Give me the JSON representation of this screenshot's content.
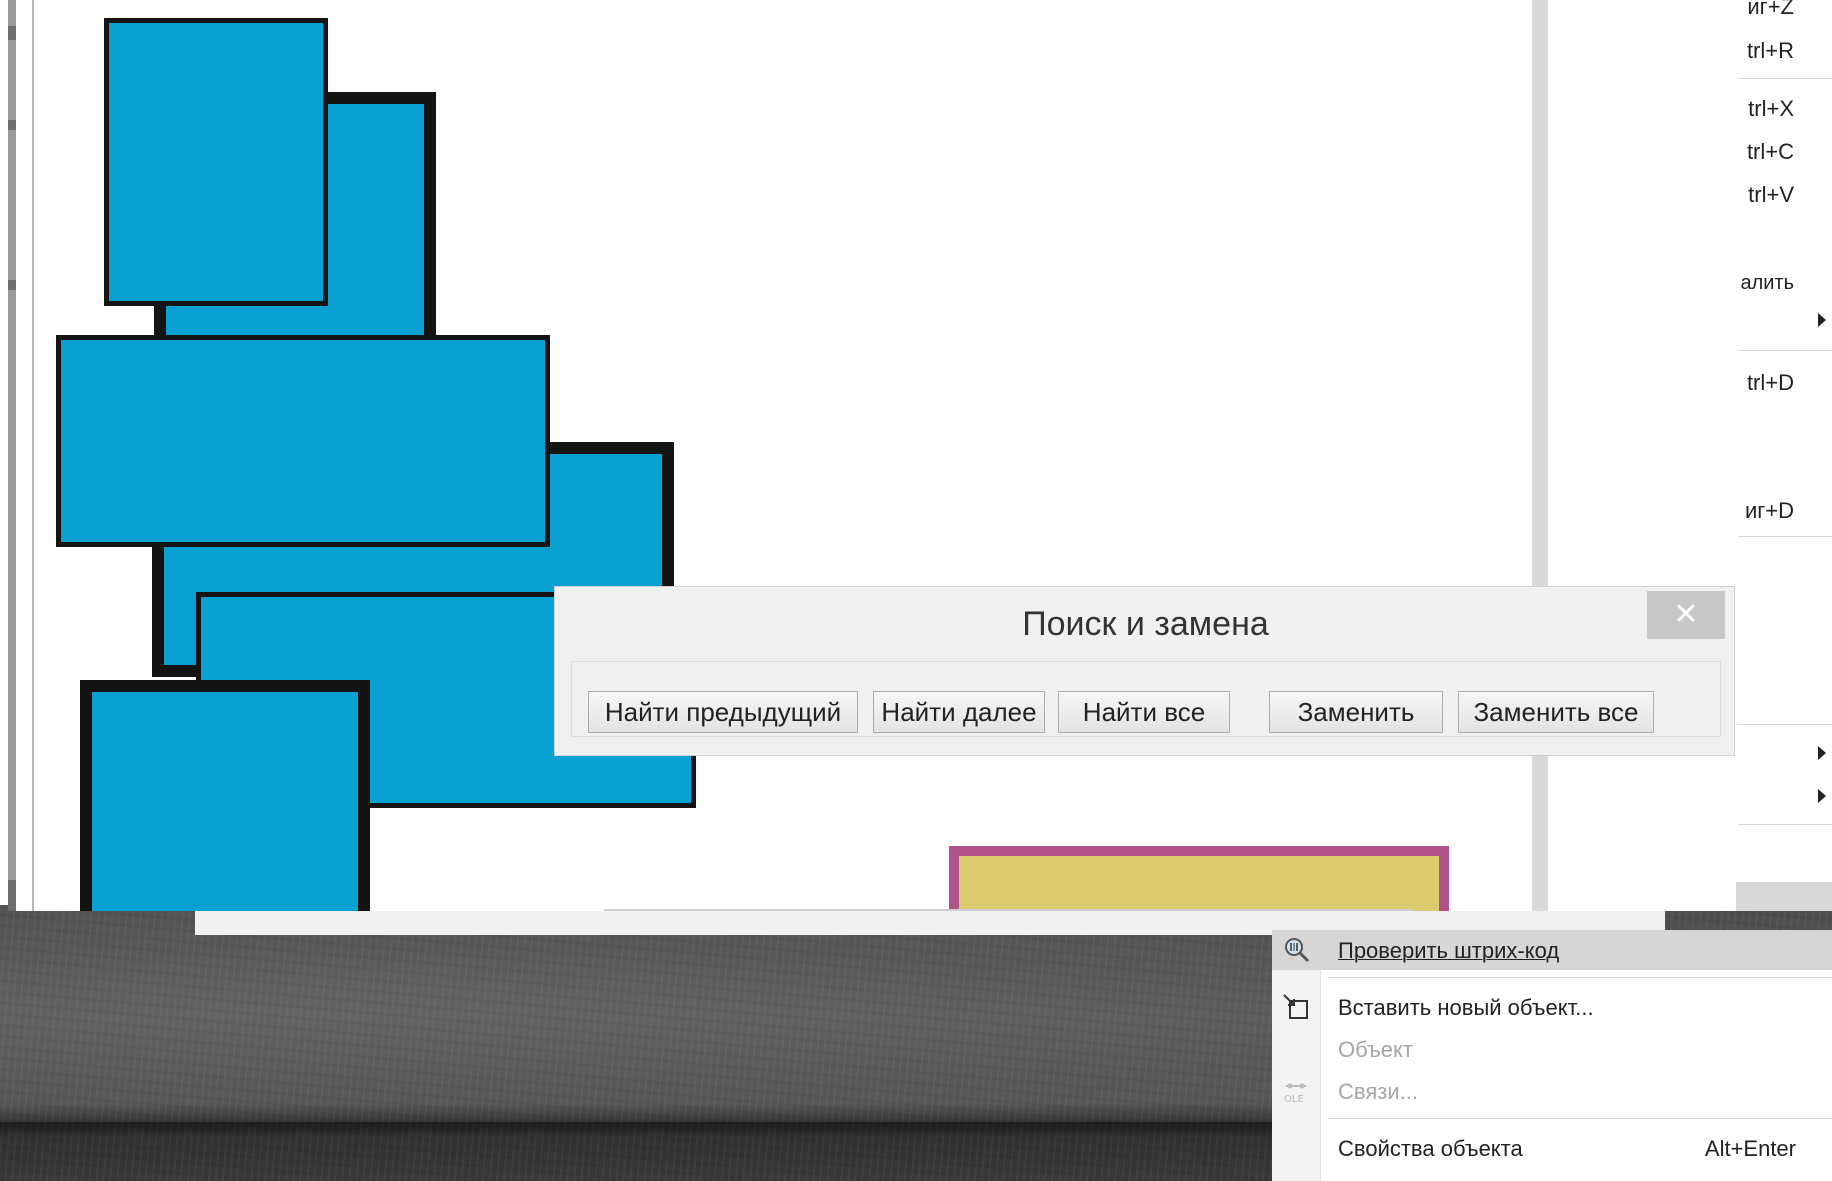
{
  "dialog": {
    "title": "Поиск и замена",
    "buttons": {
      "find_previous": "Найти предыдущий",
      "find_next": "Найти далее",
      "find_all": "Найти все",
      "replace": "Заменить",
      "replace_all": "Заменить все"
    }
  },
  "context_menu": {
    "items": [
      {
        "shortcut": "иг+Z"
      },
      {
        "shortcut": "trl+R"
      },
      {
        "shortcut": "trl+X"
      },
      {
        "shortcut": "trl+C"
      },
      {
        "shortcut": "trl+V"
      },
      {
        "label": "алить"
      },
      {
        "shortcut": "trl+D"
      },
      {
        "shortcut": "иг+D"
      }
    ]
  },
  "object_menu": {
    "items": [
      {
        "label": "Проверить штрих-код",
        "icon": "barcode-search-icon",
        "highlighted": true
      },
      {
        "label": "Вставить новый объект...",
        "icon": "insert-object-icon"
      },
      {
        "label": "Объект",
        "disabled": true
      },
      {
        "label": "Связи...",
        "icon": "ole-links-icon",
        "disabled": true
      },
      {
        "label": "Свойства объекта",
        "shortcut": "Alt+Enter"
      }
    ]
  },
  "colors": {
    "shape_fill": "#0aa0d2",
    "shape_outline": "#141414",
    "yellow_fill": "#dccc6f",
    "magenta_outline": "#b2528a"
  }
}
